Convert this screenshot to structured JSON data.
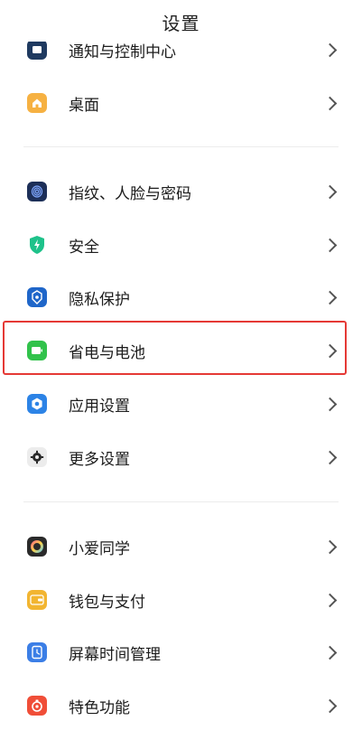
{
  "header": {
    "title": "设置"
  },
  "sections": [
    {
      "items": [
        {
          "label": "通知与控制中心",
          "icon": "notification-center-icon",
          "color": "#1f3a60"
        },
        {
          "label": "桌面",
          "icon": "home-icon",
          "color": "#f6b142"
        }
      ]
    },
    {
      "items": [
        {
          "label": "指纹、人脸与密码",
          "icon": "fingerprint-icon",
          "color": "#1d2f58"
        },
        {
          "label": "安全",
          "icon": "shield-icon",
          "color": "#1ec28a"
        },
        {
          "label": "隐私保护",
          "icon": "privacy-icon",
          "color": "#1f66c9"
        },
        {
          "label": "省电与电池",
          "icon": "battery-icon",
          "color": "#31c24b"
        },
        {
          "label": "应用设置",
          "icon": "app-settings-icon",
          "color": "#2c83e6"
        },
        {
          "label": "更多设置",
          "icon": "gear-icon",
          "color": "#6e6e6e"
        }
      ]
    },
    {
      "items": [
        {
          "label": "小爱同学",
          "icon": "xiaoai-icon",
          "color": "#2a2a2a"
        },
        {
          "label": "钱包与支付",
          "icon": "wallet-icon",
          "color": "#f2b531"
        },
        {
          "label": "屏幕时间管理",
          "icon": "screen-time-icon",
          "color": "#3b7ee6"
        },
        {
          "label": "特色功能",
          "icon": "features-icon",
          "color": "#f04e38"
        }
      ]
    }
  ]
}
